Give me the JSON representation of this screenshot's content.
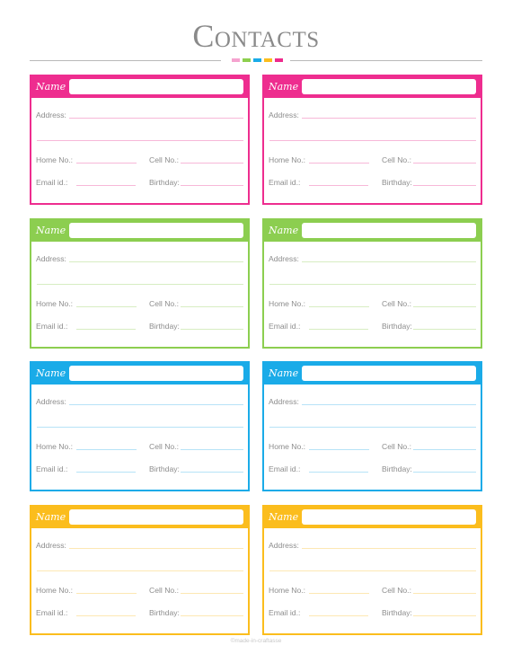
{
  "page": {
    "title": "Contacts",
    "footer": "©made-in-craftasse",
    "divider_colors": [
      "#f5a3cf",
      "#8dcf4f",
      "#1aabe8",
      "#fbbd1d",
      "#ee2a8c"
    ]
  },
  "card_labels": {
    "name": "Name",
    "address": "Address:",
    "home": "Home No.:",
    "cell": "Cell No.:",
    "email": "Email id.:",
    "birthday": "Birthday:"
  },
  "cards": [
    {
      "color": "#ee2d8f",
      "line": "#f7b8d8",
      "name": "",
      "address": "",
      "home": "",
      "cell": "",
      "email": "",
      "birthday": ""
    },
    {
      "color": "#ee2d8f",
      "line": "#f7b8d8",
      "name": "",
      "address": "",
      "home": "",
      "cell": "",
      "email": "",
      "birthday": ""
    },
    {
      "color": "#8cce50",
      "line": "#d7edc2",
      "name": "",
      "address": "",
      "home": "",
      "cell": "",
      "email": "",
      "birthday": ""
    },
    {
      "color": "#8cce50",
      "line": "#d7edc2",
      "name": "",
      "address": "",
      "home": "",
      "cell": "",
      "email": "",
      "birthday": ""
    },
    {
      "color": "#1aabe8",
      "line": "#b7e3f7",
      "name": "",
      "address": "",
      "home": "",
      "cell": "",
      "email": "",
      "birthday": ""
    },
    {
      "color": "#1aabe8",
      "line": "#b7e3f7",
      "name": "",
      "address": "",
      "home": "",
      "cell": "",
      "email": "",
      "birthday": ""
    },
    {
      "color": "#fbbd1d",
      "line": "#fde8b3",
      "name": "",
      "address": "",
      "home": "",
      "cell": "",
      "email": "",
      "birthday": ""
    },
    {
      "color": "#fbbd1d",
      "line": "#fde8b3",
      "name": "",
      "address": "",
      "home": "",
      "cell": "",
      "email": "",
      "birthday": ""
    }
  ]
}
